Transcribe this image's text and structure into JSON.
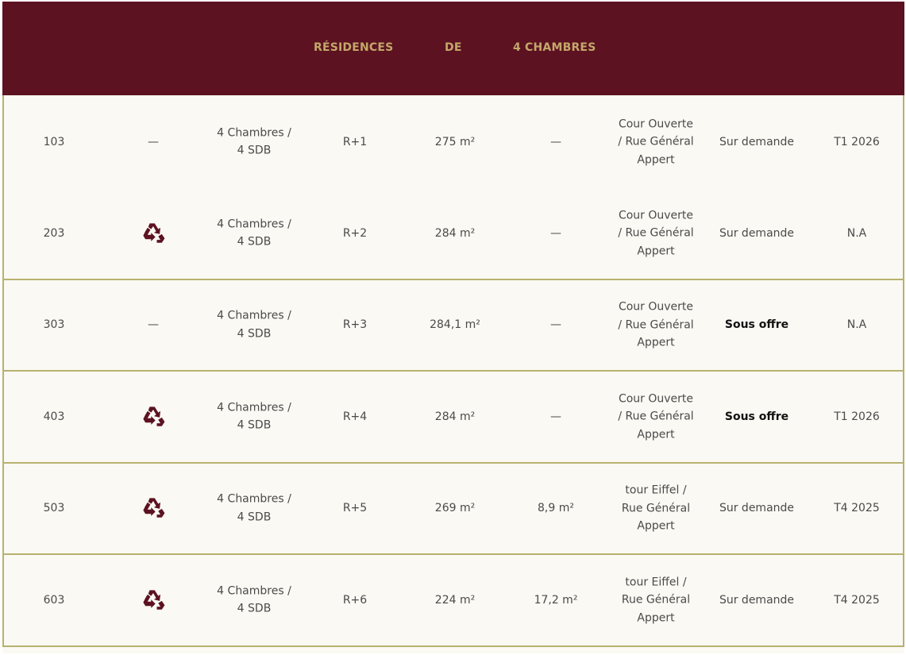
{
  "header": {
    "col1": "RÉSIDENCES",
    "col2": "DE",
    "col3": "4 CHAMBRES"
  },
  "colors": {
    "header_bg": "#5c1221",
    "header_text": "#c3a86a",
    "border": "#b8b170",
    "row_bg": "#faf9f3",
    "icon": "#5c1221"
  },
  "rows": [
    {
      "lot": "103",
      "icon": "—",
      "rooms": "4 Chambres /\n4 SDB",
      "floor": "R+1",
      "surface": "275 m²",
      "exterior": "—",
      "view": "Cour Ouverte\n/ Rue Général\nAppert",
      "price": "Sur demande",
      "delivery": "T1 2026",
      "renovated": false,
      "price_bold": false
    },
    {
      "lot": "203",
      "icon": "recycle-icon",
      "rooms": "4 Chambres /\n4 SDB",
      "floor": "R+2",
      "surface": "284 m²",
      "exterior": "—",
      "view": "Cour Ouverte\n/ Rue Général\nAppert",
      "price": "Sur demande",
      "delivery": "N.A",
      "renovated": true,
      "price_bold": false
    },
    {
      "lot": "303",
      "icon": "—",
      "rooms": "4 Chambres /\n4 SDB",
      "floor": "R+3",
      "surface": "284,1 m²",
      "exterior": "—",
      "view": "Cour Ouverte\n/ Rue Général\nAppert",
      "price": "Sous offre",
      "delivery": "N.A",
      "renovated": false,
      "price_bold": true
    },
    {
      "lot": "403",
      "icon": "recycle-icon",
      "rooms": "4 Chambres /\n4 SDB",
      "floor": "R+4",
      "surface": "284 m²",
      "exterior": "—",
      "view": "Cour Ouverte\n/ Rue Général\nAppert",
      "price": "Sous offre",
      "delivery": "T1 2026",
      "renovated": true,
      "price_bold": true
    },
    {
      "lot": "503",
      "icon": "recycle-icon",
      "rooms": "4 Chambres /\n4 SDB",
      "floor": "R+5",
      "surface": "269 m²",
      "exterior": "8,9 m²",
      "view": "tour Eiffel /\nRue Général\nAppert",
      "price": "Sur demande",
      "delivery": "T4 2025",
      "renovated": true,
      "price_bold": false
    },
    {
      "lot": "603",
      "icon": "recycle-icon",
      "rooms": "4 Chambres /\n4 SDB",
      "floor": "R+6",
      "surface": "224 m²",
      "exterior": "17,2 m²",
      "view": "tour Eiffel /\nRue Général\nAppert",
      "price": "Sur demande",
      "delivery": "T4 2025",
      "renovated": true,
      "price_bold": false
    }
  ]
}
